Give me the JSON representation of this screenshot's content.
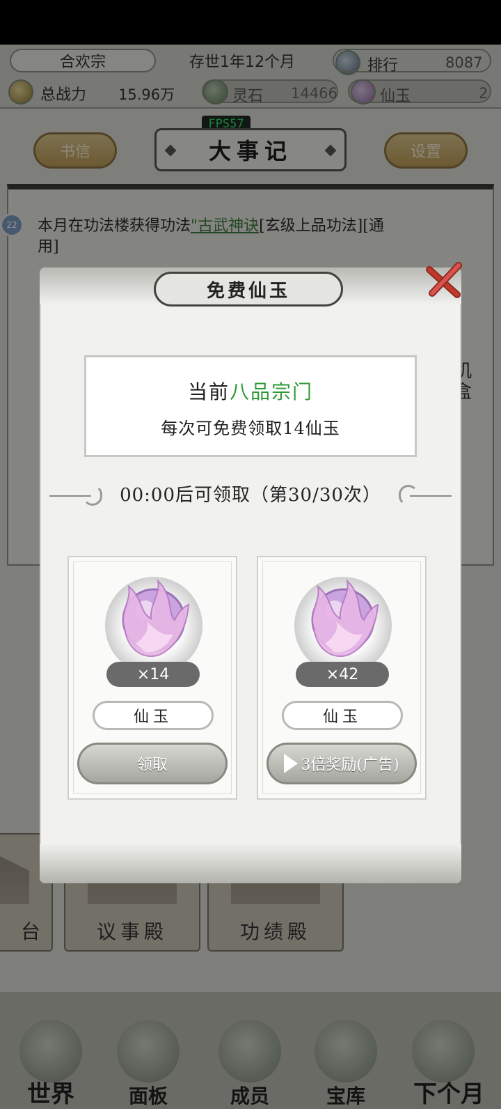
{
  "hud": {
    "sect_name": "合欢宗",
    "age": "存世1年12个月",
    "rank_label": "排行",
    "rank_value": "8087",
    "power_label": "总战力",
    "power_value": "15.96万",
    "stone_label": "灵石",
    "stone_value": "14466",
    "jade_label": "仙玉",
    "jade_value": "2",
    "fps": "FPS57"
  },
  "header": {
    "left_button": "书信",
    "title": "大事记",
    "right_button": "设置"
  },
  "log": {
    "badge": "22",
    "line1_prefix": "本月在功法楼获得功法",
    "line1_link": "\"古武神诀",
    "line1_suffix": "[玄级上品功法][通",
    "line2": "用]",
    "side_text": "机盒"
  },
  "buildings": [
    {
      "label": "台"
    },
    {
      "label": "议事殿"
    },
    {
      "label": "功绩殿"
    }
  ],
  "bottom_nav": [
    {
      "label": "世界"
    },
    {
      "label": "面板"
    },
    {
      "label": "成员"
    },
    {
      "label": "宝库"
    },
    {
      "label": "下个月"
    }
  ],
  "modal": {
    "title": "免费仙玉",
    "info_prefix": "当前",
    "info_highlight": "八品宗门",
    "info_line2": "每次可免费领取14仙玉",
    "countdown": "00:00后可领取（第30/30次）",
    "rewards": [
      {
        "qty": "×14",
        "name": "仙玉",
        "action": "领取"
      },
      {
        "qty": "×42",
        "name": "仙玉",
        "action": "3倍奖励(广告)"
      }
    ]
  },
  "colors": {
    "highlight_green": "#2f9a35",
    "close_red": "#c0392b",
    "jade_purple": "#c9a4de"
  }
}
